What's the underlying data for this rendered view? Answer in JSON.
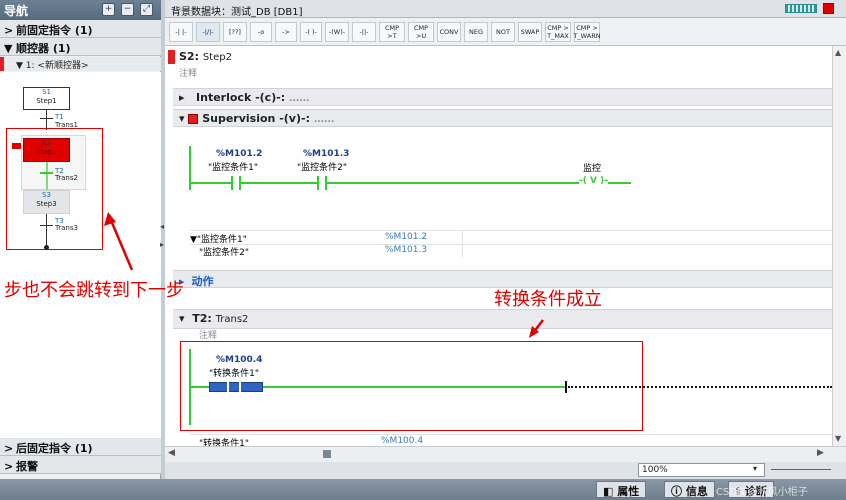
{
  "nav": {
    "title": "导航",
    "sections": [
      {
        "label": "前固定指令 (1)",
        "arrow": ">"
      },
      {
        "label": "顺控器 (1)",
        "arrow": "▼"
      }
    ],
    "sequencer_item": "▼ 1: <新顺控器>",
    "bottom_sections": [
      {
        "label": "后固定指令 (1)",
        "arrow": ">"
      },
      {
        "label": "报警",
        "arrow": ">"
      }
    ],
    "graph": {
      "s1_num": "S1",
      "s1_name": "Step1",
      "t1_num": "T1",
      "t1_name": "Trans1",
      "s2_num": "S2",
      "s2_name": "Step2",
      "t2_num": "T2",
      "t2_name": "Trans2",
      "s3_num": "S3",
      "s3_name": "Step3",
      "t3_num": "T3",
      "t3_name": "Trans3"
    },
    "toolbar_icons": [
      "zoom-in-icon",
      "zoom-out-icon",
      "fit-icon"
    ]
  },
  "editor": {
    "header": "背景数据块：测试_DB [DB1]",
    "toolbar": [
      "-| |-",
      "-|/|-",
      "[??]",
      "-o",
      "->",
      "-( )-",
      "-(W)-",
      "-||-",
      "CMP >T",
      "CMP >U",
      "CONV",
      "NEG",
      "NOT",
      "SWAP",
      "CMP > T_MAX",
      "CMP > T_WARN"
    ],
    "step_title_code": "S2:",
    "step_title_name": "Step2",
    "step_comment": "注释",
    "interlock_label": "Interlock -(c)-:",
    "interlock_dots": "......",
    "supervision_label": "Supervision -(v)-:",
    "supervision_dots": "......",
    "contact1_addr": "%M101.2",
    "contact1_name": "\"监控条件1\"",
    "contact2_addr": "%M101.3",
    "contact2_name": "\"监控条件2\"",
    "coil_name": "监控",
    "coil_symbol": "-( V )-",
    "var_rows": [
      {
        "name": "▼\"监控条件1\"",
        "addr": "%M101.2"
      },
      {
        "name": "\"监控条件2\"",
        "addr": "%M101.3"
      }
    ],
    "actions_label": "动作",
    "trans_title_code": "T2:",
    "trans_title_name": "Trans2",
    "trans_comment": "注释",
    "contact3_addr": "%M100.4",
    "contact3_name": "\"转换条件1\"",
    "bottom_var_name": "\"转换条件1\"",
    "bottom_var_addr": "%M100.4",
    "zoom": "100%"
  },
  "annotations": {
    "left": "步也不会跳转到下一步",
    "right": "转换条件成立"
  },
  "bottom_tabs": {
    "props": "属性",
    "info": "信息",
    "diag": "诊断"
  },
  "watermark": "CSDN @秋风小柜子",
  "colors": {
    "accent_red": "#e02020",
    "green_wire": "#33cc33",
    "annot_red": "#e00000"
  }
}
